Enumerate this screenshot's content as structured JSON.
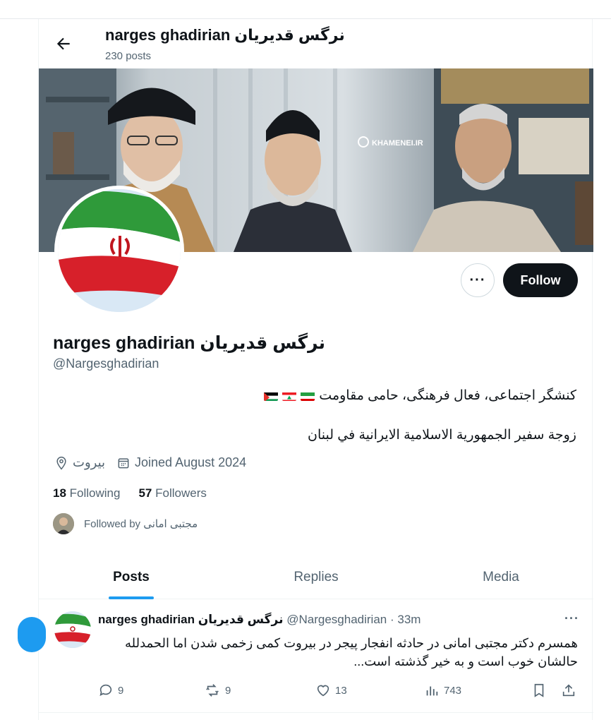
{
  "header": {
    "name": "narges ghadirian نرگس قدیریان",
    "post_count": "230 posts"
  },
  "banner": {
    "watermark": "KHAMENEI.IR"
  },
  "profile": {
    "more_label": "···",
    "follow_label": "Follow",
    "name": "narges ghadirian نرگس قدیریان",
    "handle": "@Nargesghadirian",
    "bio_line1": "کنشگر اجتماعی، فعال فرهنگی، حامی مقاومت",
    "bio_line2": "زوجة سفير الجمهورية الاسلامية الايرانية في لبنان",
    "location": "بیروت",
    "joined": "Joined August 2024",
    "following_count": "18",
    "following_label": "Following",
    "followers_count": "57",
    "followers_label": "Followers",
    "followed_by": "Followed by مجتبی امانی"
  },
  "tabs": [
    {
      "label": "Posts",
      "active": true
    },
    {
      "label": "Replies",
      "active": false
    },
    {
      "label": "Media",
      "active": false
    }
  ],
  "tweet": {
    "name": "narges ghadirian نرگس قدیریان",
    "handle": "@Nargesghadirian",
    "time": "· 33m",
    "more_label": "···",
    "text": "همسرم دکتر مجتبی امانی در حادثه انفجار پیجر در بیروت کمی زخمی شدن اما الحمدلله حالشان خوب است و به خیر گذشته است...",
    "replies": "9",
    "reposts": "9",
    "likes": "13",
    "views": "743"
  },
  "colors": {
    "accent": "#1d9bf0",
    "text": "#0f1419",
    "muted": "#536471",
    "follow_bg": "#0f1419"
  },
  "icons": [
    "back-arrow-icon",
    "location-pin-icon",
    "calendar-icon",
    "reply-icon",
    "repost-icon",
    "like-icon",
    "views-icon",
    "bookmark-icon",
    "share-icon",
    "palestine-flag-icon",
    "lebanon-flag-icon",
    "iran-flag-icon"
  ]
}
